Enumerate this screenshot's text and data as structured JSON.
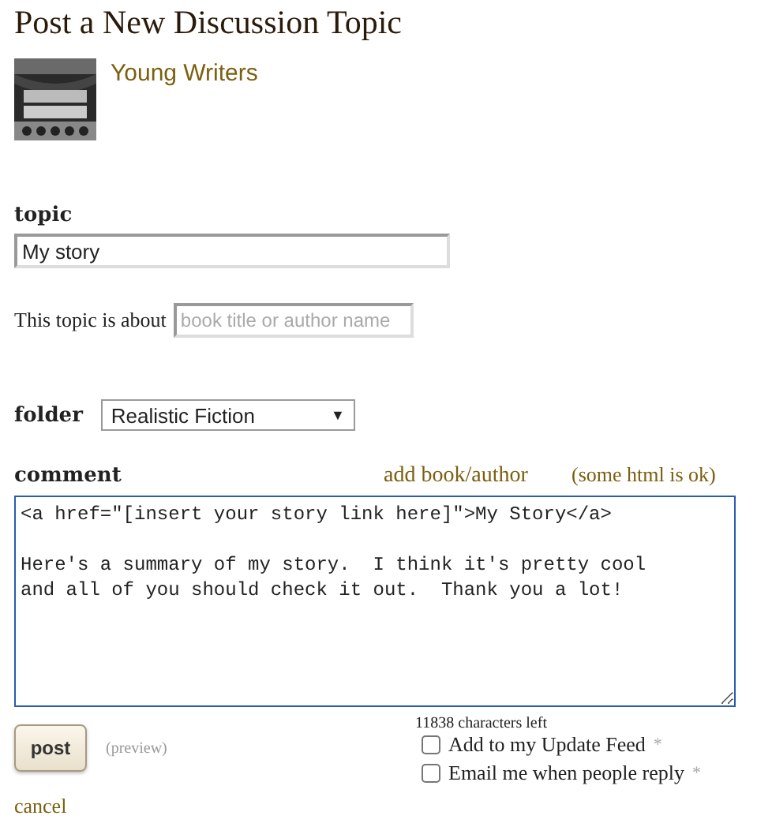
{
  "title": "Post a New Discussion Topic",
  "group": {
    "name": "Young Writers"
  },
  "topic": {
    "label": "topic",
    "value": "My story"
  },
  "about": {
    "label": "This topic is about",
    "placeholder": "book title or author name"
  },
  "folder": {
    "label": "folder",
    "value": "Realistic Fiction",
    "caret": "▼"
  },
  "comment": {
    "label": "comment",
    "add_link": "add book/author",
    "html_note": "(some html is ok)",
    "value": "<a href=\"[insert your story link here]\">My Story</a>\n\nHere's a summary of my story.  I think it's pretty cool\nand all of you should check it out.  Thank you a lot!",
    "chars_left": "11838 characters left"
  },
  "post_button": "post",
  "preview": "(preview)",
  "options": [
    {
      "label": "Add to my Update Feed",
      "mark": "*",
      "checked": false
    },
    {
      "label": "Email me when people reply",
      "mark": "*",
      "checked": false
    }
  ],
  "cancel": "cancel"
}
